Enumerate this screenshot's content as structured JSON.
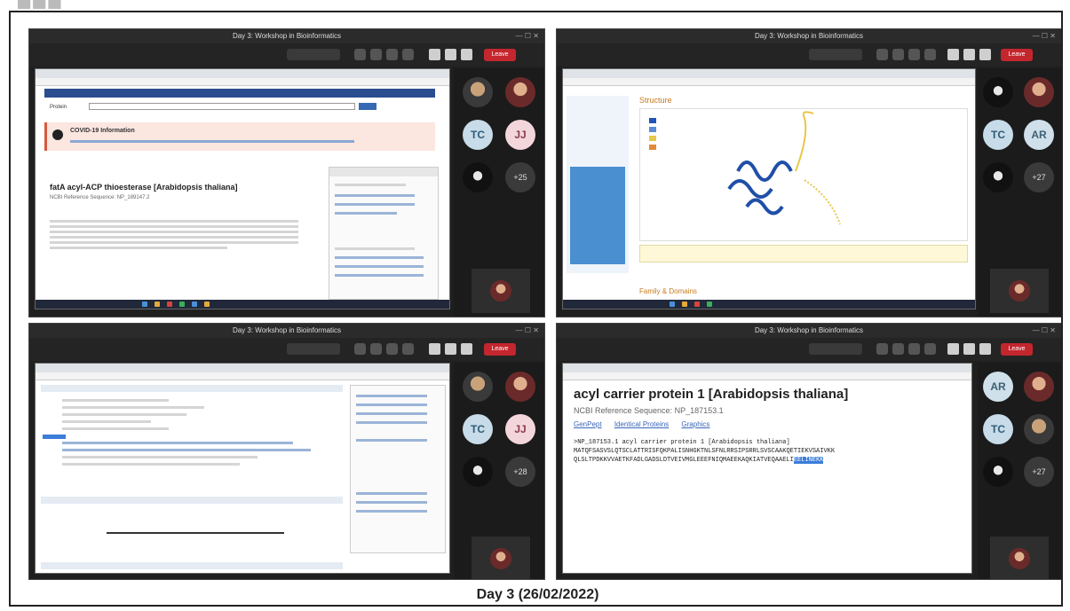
{
  "meeting_title": "Day 3: Workshop in Bioinformatics",
  "leave_label": "Leave",
  "caption": "Day 3 (26/02/2022)",
  "panel1": {
    "covid_banner": "COVID-19 Information",
    "protein_title": "fatA acyl-ACP thioesterase [Arabidopsis thaliana]",
    "ref_seq": "NCBI Reference Sequence: NP_189147.2",
    "search_label": "Protein"
  },
  "panel2": {
    "section_title": "Structure",
    "family_heading": "Family & Domains"
  },
  "panel4": {
    "title": "acyl carrier protein 1 [Arabidopsis thaliana]",
    "ref_seq": "NCBI Reference Sequence: NP_187153.1",
    "links": [
      "GenPept",
      "Identical Proteins",
      "Graphics"
    ],
    "fasta_header": ">NP_187153.1 acyl carrier protein 1 [Arabidopsis thaliana]",
    "seq_line1": "MATQFSASVSLQTSCLATTRISFQKPALISNHGKTNLSFNLRRSIPSRRLSVSCAAKQETIEKVSAIVKK",
    "seq_line2_plain": "QLSLTPDKKVVAETKFADLGADSLDTVEIVMGLEEEFNIQMAEEKAQKIATVEQAAELI",
    "seq_line2_highlight": "EELINEKK"
  },
  "participants": {
    "tc": "TC",
    "jj": "JJ",
    "ar": "AR",
    "more1": "+25",
    "more2": "+27",
    "more3": "+28",
    "more4": "+27"
  }
}
